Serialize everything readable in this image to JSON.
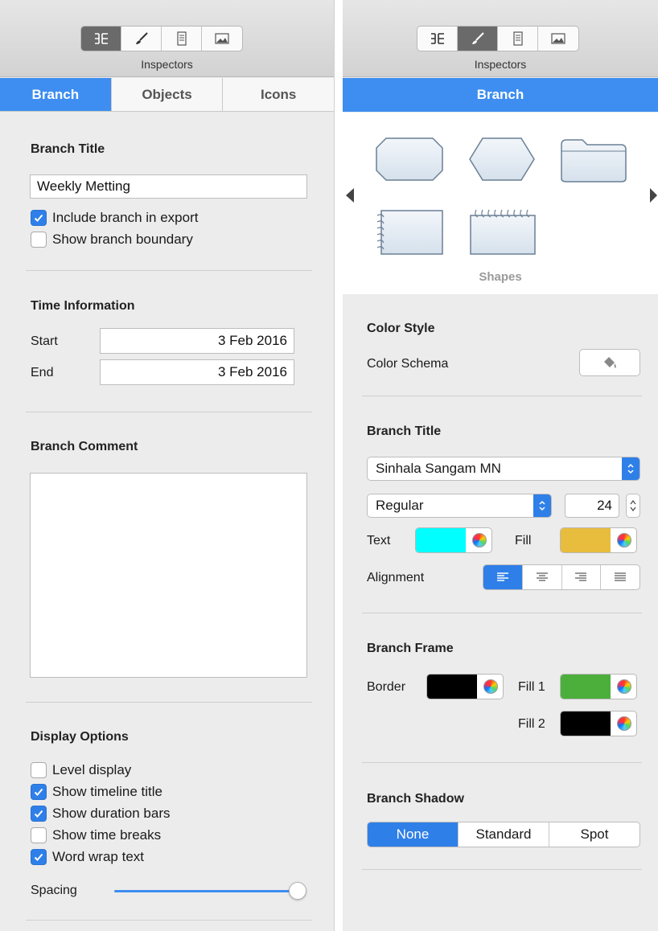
{
  "left": {
    "inspectors_label": "Inspectors",
    "toolbar_icons": [
      "hierarchy-icon",
      "brush-icon",
      "document-icon",
      "image-icon"
    ],
    "tabs": [
      {
        "label": "Branch",
        "active": true
      },
      {
        "label": "Objects",
        "active": false
      },
      {
        "label": "Icons",
        "active": false
      }
    ],
    "branch_title": {
      "heading": "Branch Title",
      "value": "Weekly Metting",
      "options": [
        {
          "label": "Include branch in export",
          "checked": true
        },
        {
          "label": "Show branch boundary",
          "checked": false
        }
      ]
    },
    "time_info": {
      "heading": "Time Information",
      "start_label": "Start",
      "start_value": "3 Feb 2016",
      "end_label": "End",
      "end_value": "3 Feb 2016"
    },
    "branch_comment": {
      "heading": "Branch Comment",
      "value": ""
    },
    "display_options": {
      "heading": "Display Options",
      "options": [
        {
          "label": "Level display",
          "checked": false
        },
        {
          "label": "Show timeline title",
          "checked": true
        },
        {
          "label": "Show duration bars",
          "checked": true
        },
        {
          "label": "Show time breaks",
          "checked": false
        },
        {
          "label": "Word wrap text",
          "checked": true
        }
      ],
      "spacing_label": "Spacing",
      "spacing_value": 1.0
    }
  },
  "right": {
    "inspectors_label": "Inspectors",
    "toolbar_icons": [
      "hierarchy-icon",
      "brush-icon",
      "document-icon",
      "image-icon"
    ],
    "tab_label": "Branch",
    "shapes_label": "Shapes",
    "color_style": {
      "heading": "Color Style",
      "schema_label": "Color Schema"
    },
    "branch_title": {
      "heading": "Branch Title",
      "font_family": "Sinhala Sangam MN",
      "font_style": "Regular",
      "font_size": "24",
      "text_label": "Text",
      "text_color": "#00ffff",
      "fill_label": "Fill",
      "fill_color": "#e8bc3c",
      "alignment_label": "Alignment",
      "alignment_options": [
        "left",
        "center",
        "right",
        "justify"
      ],
      "alignment_selected": "left"
    },
    "branch_frame": {
      "heading": "Branch Frame",
      "border_label": "Border",
      "border_color": "#000000",
      "fill1_label": "Fill 1",
      "fill1_color": "#4caf3c",
      "fill2_label": "Fill 2",
      "fill2_color": "#000000"
    },
    "branch_shadow": {
      "heading": "Branch Shadow",
      "options": [
        "None",
        "Standard",
        "Spot"
      ],
      "selected": "None"
    }
  },
  "accent_color": "#3d8ef0"
}
